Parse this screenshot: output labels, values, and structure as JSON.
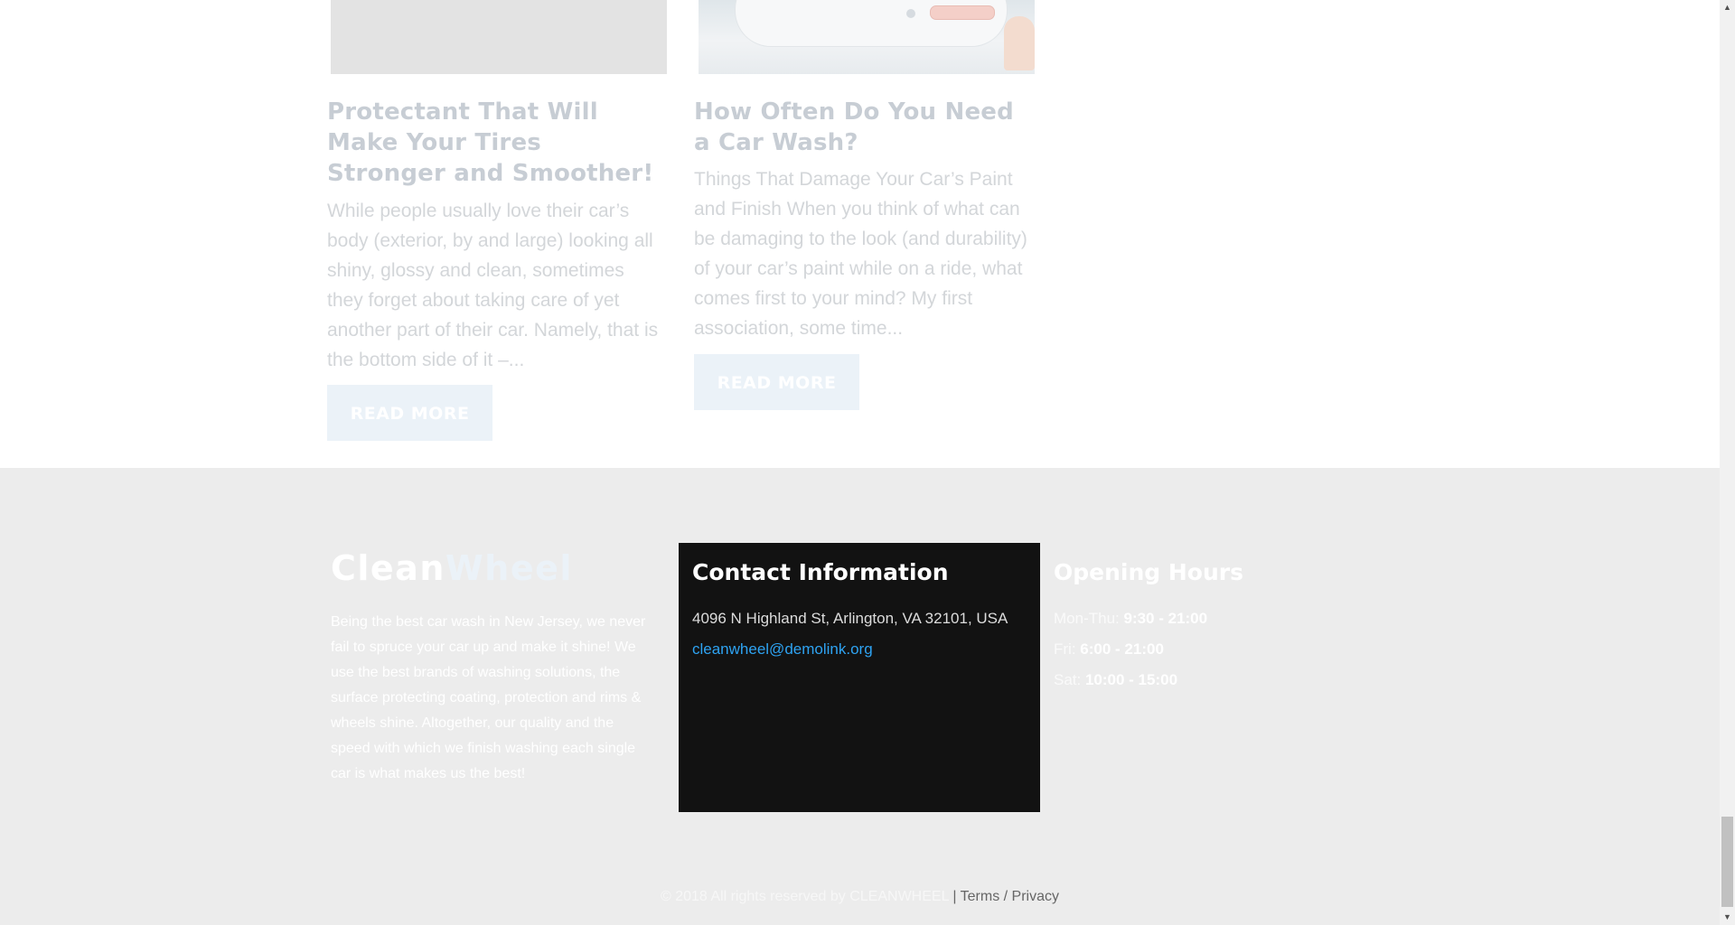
{
  "posts": [
    {
      "title": "Protectant That Will Make Your Tires Stronger and Smoother!",
      "excerpt": "  While people usually love their car’s body (exterior, by and large) looking all shiny, glossy and clean, sometimes they forget about taking care of yet another part of their car. Namely, that is the bottom side of it –...",
      "button": "READ MORE"
    },
    {
      "title": "How Often Do You Need a Car Wash?",
      "excerpt": "Things That Damage Your Car’s Paint and Finish When you think of what can be damaging to the look (and durability) of your car’s paint while on a ride, what comes first to your mind? My first association, some time...",
      "button": "READ MORE"
    }
  ],
  "footer": {
    "brand_part1": "Clean",
    "brand_part2": "Wheel",
    "about": "Being the best car wash in New Jersey, we never fail to spruce your car up and make it shine! We use the best brands of washing solutions, the surface protecting coating, protection and rims & wheels shine. Altogether, our quality and the speed with which we finish washing each single car is what makes us the best!",
    "contact": {
      "title": "Contact Information",
      "address": "4096 N Highland St, Arlington, VA 32101, USA",
      "email": "cleanwheel@demolink.org"
    },
    "hours": {
      "title": "Opening Hours",
      "rows": [
        {
          "day": "Mon-Thu: ",
          "time": "9:30 - 21:00"
        },
        {
          "day": "Fri: ",
          "time": "6:00 - 21:00"
        },
        {
          "day": "Sat: ",
          "time": "10:00 - 15:00"
        }
      ]
    },
    "copyright": "© 2018 All rights reserved by CLEANWHEEL",
    "separator": " | ",
    "terms": "Terms",
    "slash": " / ",
    "privacy": "Privacy"
  },
  "colors": {
    "accent_link": "#2ea3f2",
    "contact_bg": "#121212",
    "footer_bg": "#ececec"
  },
  "icons": [
    "scroll-up-arrow-icon",
    "scroll-down-arrow-icon"
  ]
}
